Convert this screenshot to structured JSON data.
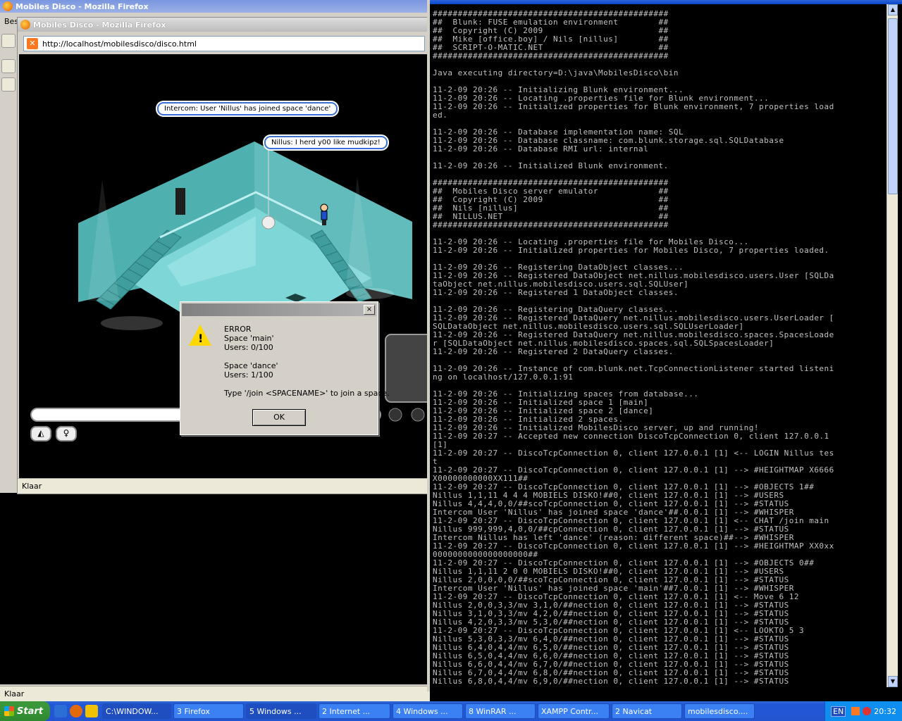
{
  "background_window": {
    "title": "Mobiles Disco - Mozilla Firefox",
    "menu_fragment": "Bes",
    "status": "Klaar"
  },
  "browser": {
    "title": "Mobiles Disco - Mozilla Firefox",
    "url": "http://localhost/mobilesdisco/disco.html",
    "status": "Klaar"
  },
  "game": {
    "bubble_intercom": "Intercom: User 'Nillus' has joined space 'dance'",
    "bubble_nillus": "Nillus: I herd y00 like mudkipz!"
  },
  "dialog": {
    "message": "ERROR\nSpace 'main'\nUsers: 0/100\n\nSpace 'dance'\nUsers: 1/100\n\nType '/join <SPACENAME>' to join a space.",
    "ok_label": "OK",
    "close_label": "×"
  },
  "console": {
    "text": "###############################################\n##  Blunk: FUSE emulation environment        ##\n##  Copyright (C) 2009                       ##\n##  Mike [office.boy] / Nils [nillus]        ##\n##  SCRIPT-O-MATIC.NET                       ##\n###############################################\n\nJava executing directory=D:\\java\\MobilesDisco\\bin\n\n11-2-09 20:26 -- Initializing Blunk environment...\n11-2-09 20:26 -- Locating .properties file for Blunk environment...\n11-2-09 20:26 -- Initialized properties for Blunk environment, 7 properties load\ned.\n\n11-2-09 20:26 -- Database implementation name: SQL\n11-2-09 20:26 -- Database classname: com.blunk.storage.sql.SQLDatabase\n11-2-09 20:26 -- Database RMI url: internal\n\n11-2-09 20:26 -- Initialized Blunk environment.\n\n###############################################\n##  Mobiles Disco server emulator            ##\n##  Copyright (C) 2009                       ##\n##  Nils [nillus]                            ##\n##  NILLUS.NET                               ##\n###############################################\n\n11-2-09 20:26 -- Locating .properties file for Mobiles Disco...\n11-2-09 20:26 -- Initialized properties for Mobiles Disco, 7 properties loaded.\n\n11-2-09 20:26 -- Registering DataObject classes...\n11-2-09 20:26 -- Registered DataObject net.nillus.mobilesdisco.users.User [SQLDa\ntaObject net.nillus.mobilesdisco.users.sql.SQLUser]\n11-2-09 20:26 -- Registered 1 DataObject classes.\n\n11-2-09 20:26 -- Registering DataQuery classes...\n11-2-09 20:26 -- Registered DataQuery net.nillus.mobilesdisco.users.UserLoader [\nSQLDataObject net.nillus.mobilesdisco.users.sql.SQLUserLoader]\n11-2-09 20:26 -- Registered DataQuery net.nillus.mobilesdisco.spaces.SpacesLoade\nr [SQLDataObject net.nillus.mobilesdisco.spaces.sql.SQLSpacesLoader]\n11-2-09 20:26 -- Registered 2 DataQuery classes.\n\n11-2-09 20:26 -- Instance of com.blunk.net.TcpConnectionListener started listeni\nng on localhost/127.0.0.1:91\n\n11-2-09 20:26 -- Initializing spaces from database...\n11-2-09 20:26 -- Initialized space 1 [main]\n11-2-09 20:26 -- Initialized space 2 [dance]\n11-2-09 20:26 -- Initialized 2 spaces.\n11-2-09 20:26 -- Initialized MobilesDisco server, up and running!\n11-2-09 20:27 -- Accepted new connection DiscoTcpConnection 0, client 127.0.0.1\n[1]\n11-2-09 20:27 -- DiscoTcpConnection 0, client 127.0.0.1 [1] <-- LOGIN Nillus tes\nt\n11-2-09 20:27 -- DiscoTcpConnection 0, client 127.0.0.1 [1] --> #HEIGHTMAP X6666\nX00000000000XX111##\n11-2-09 20:27 -- DiscoTcpConnection 0, client 127.0.0.1 [1] --> #OBJECTS 1##\nNillus 1,1,11 4 4 4 MOBIELS DISKO!##0, client 127.0.0.1 [1] --> #USERS\nNillus 4,4,4,0,0/##scoTcpConnection 0, client 127.0.0.1 [1] --> #STATUS\nIntercom User 'Nillus' has joined space 'dance'##.0.0.1 [1] --> #WHISPER\n11-2-09 20:27 -- DiscoTcpConnection 0, client 127.0.0.1 [1] <-- CHAT /join main\nNillus 999,999,4,0,0/##cpConnection 0, client 127.0.0.1 [1] --> #STATUS\nIntercom Nillus has left 'dance' (reason: different space)##--> #WHISPER\n11-2-09 20:27 -- DiscoTcpConnection 0, client 127.0.0.1 [1] --> #HEIGHTMAP XX0xx\n0000000000000000000##\n11-2-09 20:27 -- DiscoTcpConnection 0, client 127.0.0.1 [1] --> #OBJECTS 0##\nNillus 1,1,11 2 0 0 MOBIELS DISKO!##0, client 127.0.0.1 [1] --> #USERS\nNillus 2,0,0,0,0/##scoTcpConnection 0, client 127.0.0.1 [1] --> #STATUS\nIntercom User 'Nillus' has joined space 'main'##7.0.0.1 [1] --> #WHISPER\n11-2-09 20:27 -- DiscoTcpConnection 0, client 127.0.0.1 [1] <-- Move 6 12\nNillus 2,0,0,3,3/mv 3,1,0/##nection 0, client 127.0.0.1 [1] --> #STATUS\nNillus 3,1,0,3,3/mv 4,2,0/##nection 0, client 127.0.0.1 [1] --> #STATUS\nNillus 4,2,0,3,3/mv 5,3,0/##nection 0, client 127.0.0.1 [1] --> #STATUS\n11-2-09 20:27 -- DiscoTcpConnection 0, client 127.0.0.1 [1] <-- LOOKTO 5 3\nNillus 5,3,0,3,3/mv 6,4,0/##nection 0, client 127.0.0.1 [1] --> #STATUS\nNillus 6,4,0,4,4/mv 6,5,0/##nection 0, client 127.0.0.1 [1] --> #STATUS\nNillus 6,5,0,4,4/mv 6,6,0/##nection 0, client 127.0.0.1 [1] --> #STATUS\nNillus 6,6,0,4,4/mv 6,7,0/##nection 0, client 127.0.0.1 [1] --> #STATUS\nNillus 6,7,0,4,4/mv 6,8,0/##nection 0, client 127.0.0.1 [1] --> #STATUS\nNillus 6,8,0,4,4/mv 6,9,0/##nection 0, client 127.0.0.1 [1] --> #STATUS"
  },
  "taskbar": {
    "start": "Start",
    "tasks": [
      {
        "label": "C:\\WINDOW...",
        "icon": "cmd-icon"
      },
      {
        "label": "3 Firefox",
        "icon": "firefox-icon"
      },
      {
        "label": "5 Windows ...",
        "icon": "messenger-icon"
      },
      {
        "label": "2 Internet ...",
        "icon": "ie-icon"
      },
      {
        "label": "4 Windows ...",
        "icon": "folder-icon"
      },
      {
        "label": "8 WinRAR ...",
        "icon": "winrar-icon"
      },
      {
        "label": "XAMPP Contr...",
        "icon": "xampp-icon"
      },
      {
        "label": "2 Navicat",
        "icon": "navicat-icon"
      },
      {
        "label": "mobilesdisco....",
        "icon": "app-icon"
      }
    ],
    "lang": "EN",
    "clock": "20:32"
  }
}
